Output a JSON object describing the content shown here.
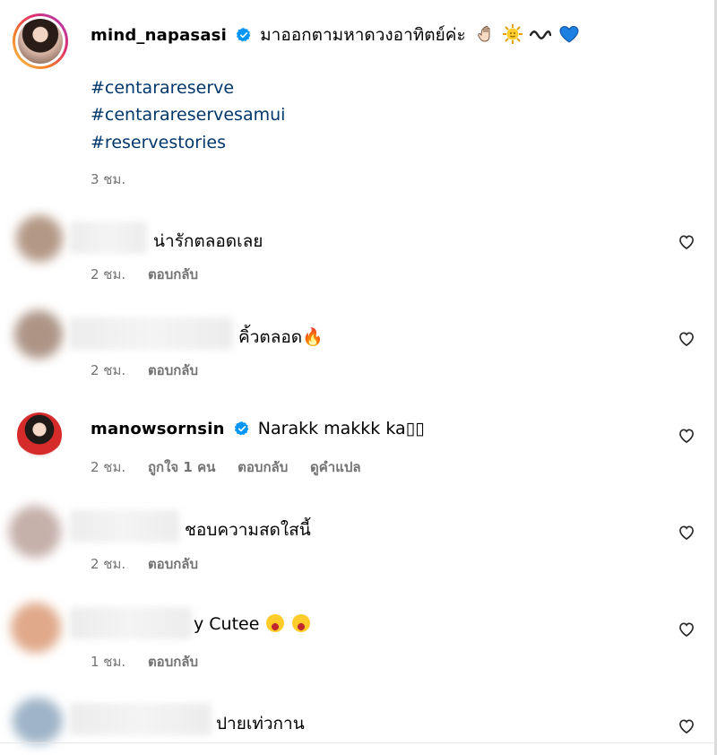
{
  "post": {
    "username": "mind_napasasi",
    "caption": "มาออกตามหาดวงอาทิตย์ค่ะ",
    "caption_emojis": "👋🏻 🌞 〰️ 💙",
    "hashtags": [
      "#centarareserve",
      "#centarareservesamui",
      "#reservestories"
    ],
    "time": "3 ชม."
  },
  "comments": [
    {
      "username": "",
      "text": "น่ารักตลอดเลย",
      "time": "2 ชม.",
      "likes": "",
      "reply": "ตอบกลับ",
      "translate": ""
    },
    {
      "username": "",
      "text": "คิ้วตลอด🔥",
      "time": "2 ชม.",
      "likes": "",
      "reply": "ตอบกลับ",
      "translate": ""
    },
    {
      "username": "manowsornsin",
      "text": "Narakk makkk ka",
      "text_suffix": "▯▯",
      "time": "2 ชม.",
      "likes": "ถูกใจ 1 คน",
      "reply": "ตอบกลับ",
      "translate": "ดูคำแปล"
    },
    {
      "username": "",
      "text": "ชอบความสดใสนี้",
      "time": "2 ชม.",
      "likes": "",
      "reply": "ตอบกลับ",
      "translate": ""
    },
    {
      "username": "",
      "text": "y Cutee",
      "time": "1 ชม.",
      "likes": "",
      "reply": "ตอบกลับ",
      "translate": ""
    },
    {
      "username": "",
      "text": "ปายเท่วกาน",
      "time": "",
      "likes": "",
      "reply": "",
      "translate": ""
    }
  ],
  "colors": {
    "hashtag": "#00376b",
    "meta": "#737373",
    "verified": "#0095f6",
    "divider": "#dbdbdb"
  },
  "icons": {
    "verified": "verified-badge-icon",
    "like": "heart-icon"
  }
}
